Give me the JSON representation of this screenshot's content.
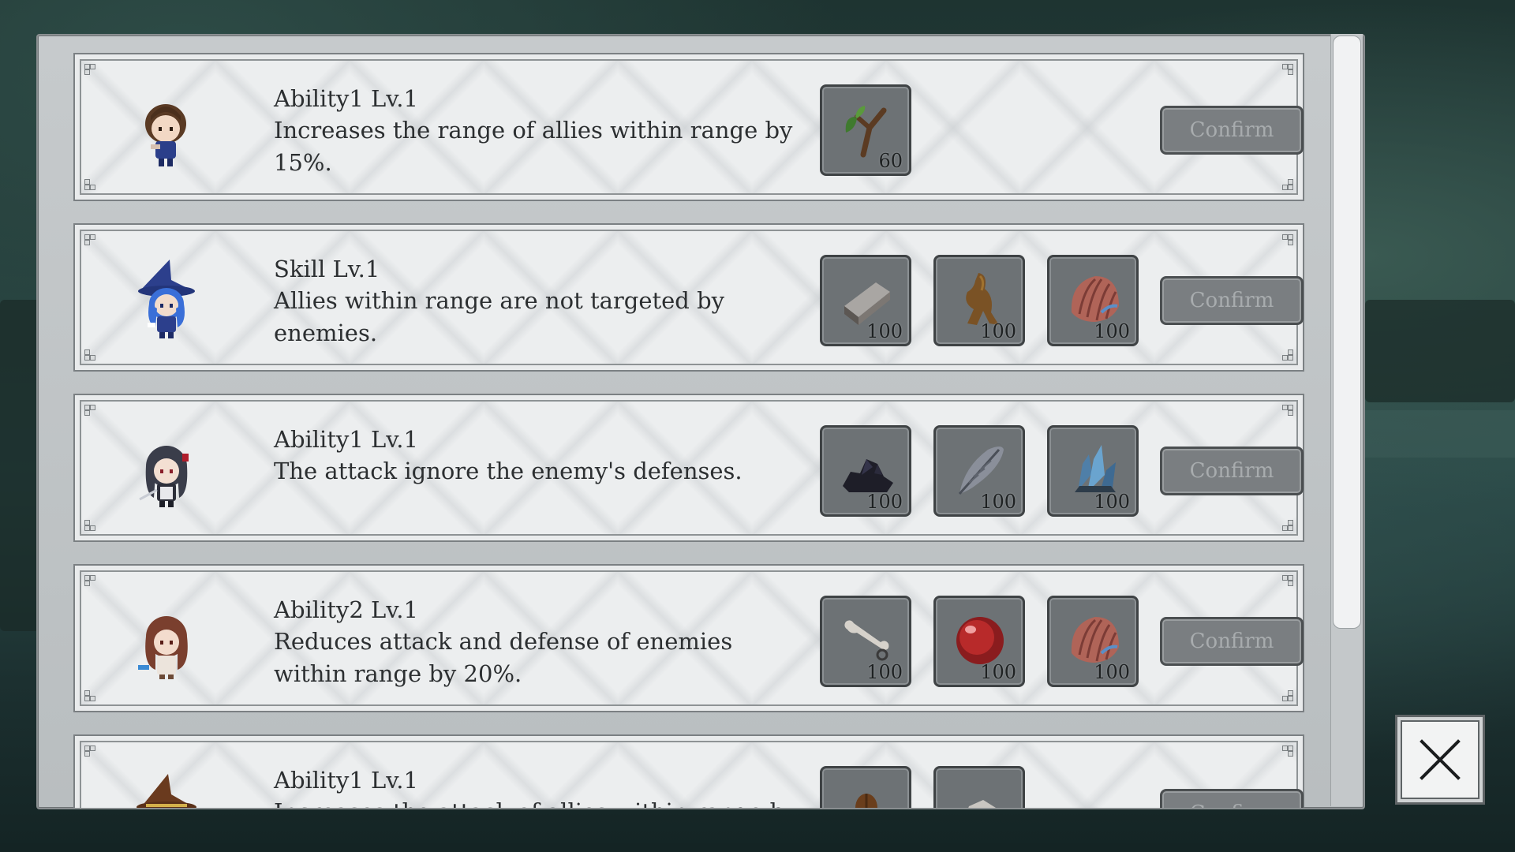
{
  "upgrades": [
    {
      "title": "Ability1 Lv.1",
      "desc": "Increases the range of allies within range by 15%.",
      "materials": [
        {
          "icon": "branch-icon",
          "qty": "60"
        }
      ],
      "confirm": "Confirm"
    },
    {
      "title": "Skill Lv.1",
      "desc": "Allies within range are not targeted by enemies.",
      "materials": [
        {
          "icon": "iron-ingot-icon",
          "qty": "100"
        },
        {
          "icon": "root-icon",
          "qty": "100"
        },
        {
          "icon": "shell-icon",
          "qty": "100"
        }
      ],
      "confirm": "Confirm"
    },
    {
      "title": "Ability1 Lv.1",
      "desc": "The attack ignore the enemy's defenses.",
      "materials": [
        {
          "icon": "coal-icon",
          "qty": "100"
        },
        {
          "icon": "feather-icon",
          "qty": "100"
        },
        {
          "icon": "crystal-icon",
          "qty": "100"
        }
      ],
      "confirm": "Confirm"
    },
    {
      "title": "Ability2 Lv.1",
      "desc": "Reduces attack and defense of enemies within range by 20%.",
      "materials": [
        {
          "icon": "bone-icon",
          "qty": "100"
        },
        {
          "icon": "red-orb-icon",
          "qty": "100"
        },
        {
          "icon": "shell-icon",
          "qty": "100"
        }
      ],
      "confirm": "Confirm"
    },
    {
      "title": "Ability1 Lv.1",
      "desc": "Increases the attack of allies within range by",
      "materials": [
        {
          "icon": "seed-icon",
          "qty": ""
        },
        {
          "icon": "stone-icon",
          "qty": ""
        }
      ],
      "confirm": "Confirm"
    }
  ],
  "colors": {
    "panel": "#c6cacc",
    "card": "#e9ebec",
    "slot": "#6d7275",
    "confirm_text": "#a8acae"
  },
  "scroll_fraction": 0.77
}
